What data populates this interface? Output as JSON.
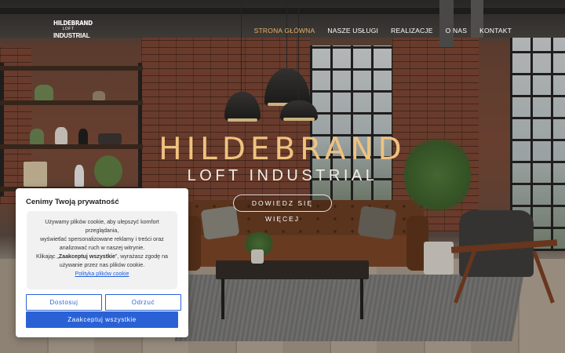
{
  "header": {
    "logo": {
      "line1": "HILDEBRAND",
      "line2": "LOFT",
      "line3": "INDUSTRIAL"
    },
    "nav": [
      {
        "label": "STRONA GŁÓWNA",
        "active": true
      },
      {
        "label": "NASZE USŁUGI",
        "active": false
      },
      {
        "label": "REALIZACJE",
        "active": false
      },
      {
        "label": "O NAS",
        "active": false
      },
      {
        "label": "KONTAKT",
        "active": false
      }
    ]
  },
  "hero": {
    "title": "HILDEBRAND",
    "subtitle": "LOFT INDUSTRIAL",
    "cta_label": "DOWIEDZ SIĘ WIĘCEJ"
  },
  "cookie_banner": {
    "title": "Cenimy Twoją prywatność",
    "text_line1": "Używamy plików cookie, aby ulepszyć komfort przeglądania,",
    "text_line2": "wyświetlać spersonalizowane reklamy i treści oraz analizować ruch w naszej witrynie.",
    "text_line3_prefix": "Klikając „",
    "text_line3_bold": "Zaakceptuj wszystkie",
    "text_line3_suffix": "”, wyrażasz zgodę na używanie przez nas plików cookie.",
    "policy_link": "Polityka plików cookie",
    "customize_label": "Dostosuj",
    "reject_label": "Odrzuć",
    "accept_label": "Zaakceptuj wszystkie"
  },
  "colors": {
    "accent_gold": "#e8b26e",
    "button_blue": "#2a62d6"
  }
}
